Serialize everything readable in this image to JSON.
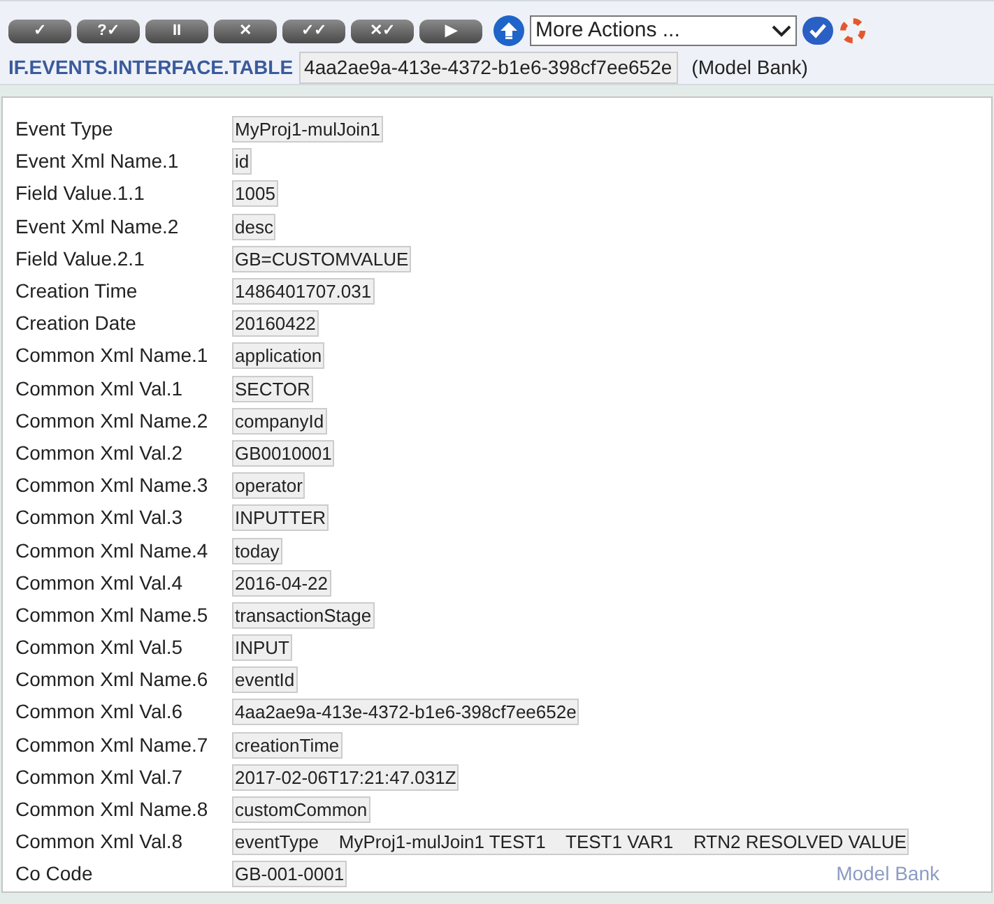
{
  "toolbar": {
    "buttons": [
      {
        "glyph": "✓"
      },
      {
        "glyph": "?✓"
      },
      {
        "glyph": "II"
      },
      {
        "glyph": "✕"
      },
      {
        "glyph": "✓✓"
      },
      {
        "glyph": "✕✓"
      },
      {
        "glyph": "▶"
      }
    ],
    "actions_dropdown": {
      "value": "More Actions ..."
    }
  },
  "header": {
    "table_name": "IF.EVENTS.INTERFACE.TABLE",
    "record_id": "4aa2ae9a-413e-4372-b1e6-398cf7ee652e",
    "company": "(Model Bank)"
  },
  "fields": [
    {
      "label": "Event Type",
      "value": "MyProj1-mulJoin1"
    },
    {
      "label": "Event Xml Name.1",
      "value": "id"
    },
    {
      "label": "Field Value.1.1",
      "value": "1005"
    },
    {
      "label": "Event Xml Name.2",
      "value": "desc"
    },
    {
      "label": "Field Value.2.1",
      "value": "GB=CUSTOMVALUE"
    },
    {
      "label": "Creation Time",
      "value": "1486401707.031"
    },
    {
      "label": "Creation Date",
      "value": "20160422"
    },
    {
      "label": "Common Xml Name.1",
      "value": "application"
    },
    {
      "label": "Common Xml Val.1",
      "value": "SECTOR"
    },
    {
      "label": "Common Xml Name.2",
      "value": "companyId"
    },
    {
      "label": "Common Xml Val.2",
      "value": "GB0010001"
    },
    {
      "label": "Common Xml Name.3",
      "value": "operator"
    },
    {
      "label": "Common Xml Val.3",
      "value": "INPUTTER"
    },
    {
      "label": "Common Xml Name.4",
      "value": "today"
    },
    {
      "label": "Common Xml Val.4",
      "value": "2016-04-22"
    },
    {
      "label": "Common Xml Name.5",
      "value": "transactionStage"
    },
    {
      "label": "Common Xml Val.5",
      "value": "INPUT"
    },
    {
      "label": "Common Xml Name.6",
      "value": "eventId"
    },
    {
      "label": "Common Xml Val.6",
      "value": "4aa2ae9a-413e-4372-b1e6-398cf7ee652e"
    },
    {
      "label": "Common Xml Name.7",
      "value": "creationTime"
    },
    {
      "label": "Common Xml Val.7",
      "value": "2017-02-06T17:21:47.031Z"
    },
    {
      "label": "Common Xml Name.8",
      "value": "customCommon"
    },
    {
      "label": "Common Xml Val.8",
      "value": "eventType    MyProj1-mulJoin1 TEST1    TEST1 VAR1    RTN2 RESOLVED VALUE"
    },
    {
      "label": "Co Code",
      "value": "GB-001-0001",
      "note": "Model Bank"
    }
  ]
}
